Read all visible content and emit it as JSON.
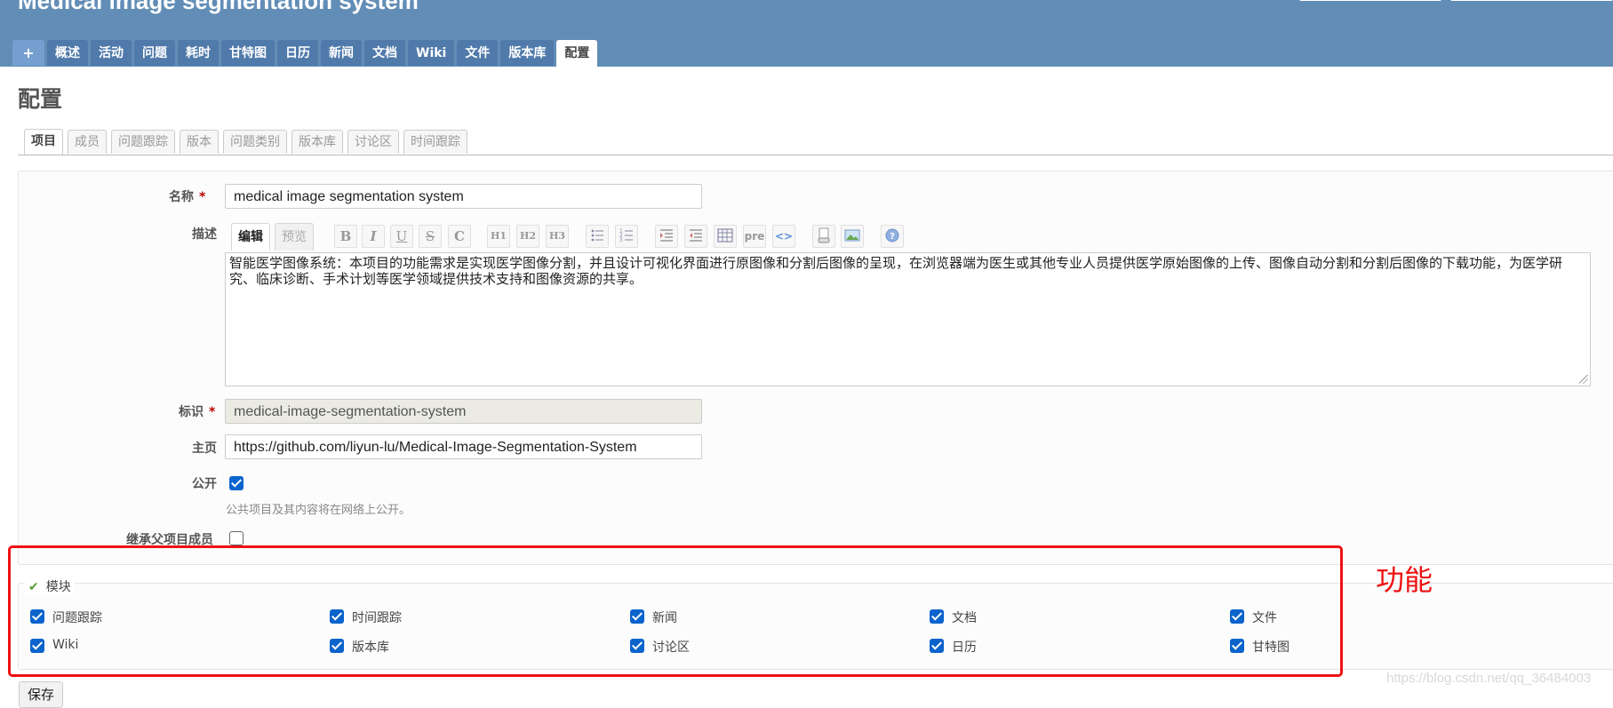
{
  "header": {
    "project_title": "Medical image segmentation system",
    "menu": [
      "+",
      "概述",
      "活动",
      "问题",
      "耗时",
      "甘特图",
      "日历",
      "新闻",
      "文档",
      "Wiki",
      "文件",
      "版本库",
      "配置"
    ],
    "selected_menu": "配置"
  },
  "page_title": "配置",
  "sub_tabs": [
    "项目",
    "成员",
    "问题跟踪",
    "版本",
    "问题类别",
    "版本库",
    "讨论区",
    "时间跟踪"
  ],
  "selected_sub_tab": "项目",
  "form": {
    "name_label": "名称",
    "required_mark": "*",
    "name_value": "medical image segmentation system",
    "description_label": "描述",
    "editor_tabs": [
      "编辑",
      "预览"
    ],
    "toolbar": {
      "bold": "B",
      "italic": "I",
      "underline": "U",
      "strike": "S",
      "code": "C",
      "h1": "H1",
      "h2": "H2",
      "h3": "H3",
      "pre": "pre",
      "inline_code": "<>",
      "help": "?"
    },
    "description_value": "智能医学图像系统：本项目的功能需求是实现医学图像分割，并且设计可视化界面进行原图像和分割后图像的呈现，在浏览器端为医生或其他专业人员提供医学原始图像的上传、图像自动分割和分割后图像的下载功能，为医学研究、临床诊断、手术计划等医学领域提供技术支持和图像资源的共享。",
    "identifier_label": "标识",
    "identifier_value": "medical-image-segmentation-system",
    "homepage_label": "主页",
    "homepage_value": "https://github.com/liyun-lu/Medical-Image-Segmentation-System",
    "public_label": "公开",
    "public_checked": true,
    "public_hint": "公共项目及其内容将在网络上公开。",
    "inherit_members_label": "继承父项目成员",
    "inherit_members_checked": false
  },
  "modules": {
    "legend": "模块",
    "items": [
      {
        "label": "问题跟踪",
        "checked": true
      },
      {
        "label": "时间跟踪",
        "checked": true
      },
      {
        "label": "新闻",
        "checked": true
      },
      {
        "label": "文档",
        "checked": true
      },
      {
        "label": "文件",
        "checked": true
      },
      {
        "label": "Wiki",
        "checked": true
      },
      {
        "label": "版本库",
        "checked": true
      },
      {
        "label": "讨论区",
        "checked": true
      },
      {
        "label": "日历",
        "checked": true
      },
      {
        "label": "甘特图",
        "checked": true
      }
    ]
  },
  "annotation": {
    "text": "功能",
    "color": "#ee1111"
  },
  "save_label": "保存",
  "watermark": "https://blog.csdn.net/qq_36484003",
  "colors": {
    "header_bg": "#628db6",
    "tab_bg": "#507aaa",
    "checkbox": "#0b63cc"
  }
}
